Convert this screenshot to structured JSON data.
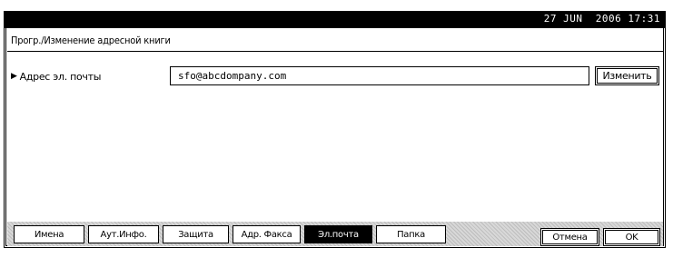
{
  "status": {
    "datetime": "27 JUN  2006 17:31"
  },
  "header": {
    "title": "Прогр./Изменение адресной книги"
  },
  "field": {
    "label": "Адрес эл. почты",
    "value": "sfo@abcdompany.com",
    "change_label": "Изменить"
  },
  "tabs": [
    {
      "label": "Имена",
      "active": false
    },
    {
      "label": "Аут.Инфо.",
      "active": false
    },
    {
      "label": "Защита",
      "active": false
    },
    {
      "label": "Адр. Факса",
      "active": false
    },
    {
      "label": "Эл.почта",
      "active": true
    },
    {
      "label": "Папка",
      "active": false
    }
  ],
  "actions": {
    "cancel_label": "Отмена",
    "ok_label": "OK"
  }
}
